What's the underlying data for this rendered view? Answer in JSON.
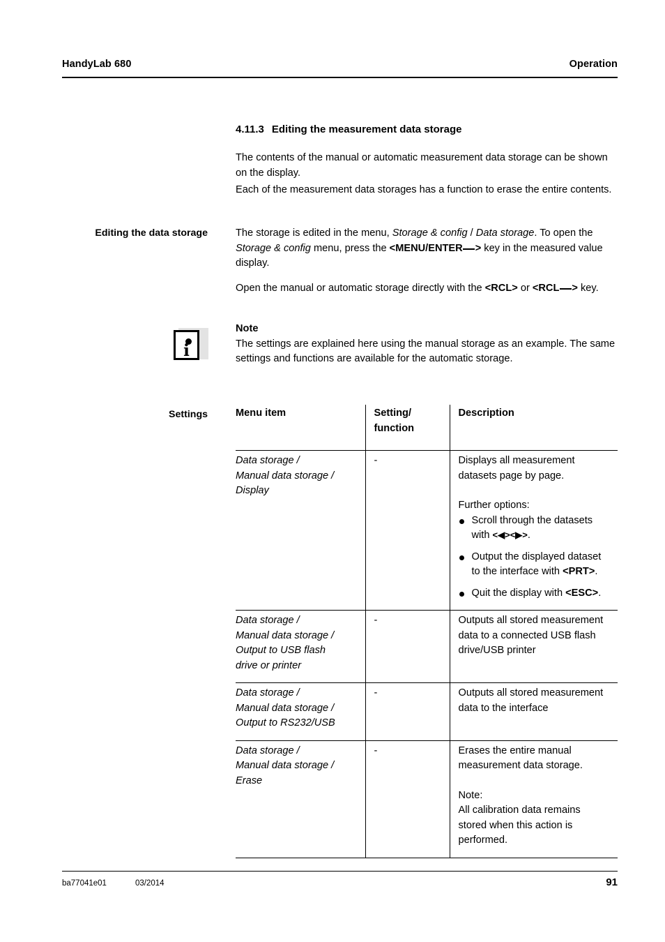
{
  "header": {
    "product": "HandyLab 680",
    "chapter": "Operation"
  },
  "footer": {
    "doc_number": "ba77041e01",
    "date": "03/2014",
    "page_number": "91"
  },
  "section": {
    "number": "4.11.3",
    "title": "Editing the measurement data storage",
    "intro_paragraph_1": "The contents of the manual or automatic measurement data storage can be shown on the display.",
    "intro_paragraph_2": "Each of the measurement data storages has a function to erase the entire contents."
  },
  "editing": {
    "marginal_label": "Editing the data storage",
    "p1_part1": "The storage is edited in the menu, ",
    "p1_menu1": "Storage & config",
    "p1_sep": " / ",
    "p1_menu2": "Data storage",
    "p1_part2": ". To open the ",
    "p1_menu3": "Storage & config",
    "p1_part3": " menu, press the ",
    "p1_key": "<MENU/ENTER",
    "p1_key_end": ">",
    "p1_part4": " key in the measured value display.",
    "p2_part1": "Open the manual or automatic storage directly with the ",
    "p2_key1": "<RCL>",
    "p2_part2": " or ",
    "p2_key2_start": "<RCL",
    "p2_key2_end": ">",
    "p2_part3": " key."
  },
  "note": {
    "icon": "info-icon",
    "icon_letter": "i",
    "title": "Note",
    "body": "The settings are explained here using the manual storage as an example. The same settings and functions are available for the automatic storage."
  },
  "settings_table": {
    "marginal_label": "Settings",
    "columns": [
      "Menu item",
      "Setting/ function",
      "Description"
    ],
    "column_headers": {
      "menu_item": "Menu item",
      "setting_function_line1": "Setting/",
      "setting_function_line2": "function",
      "description": "Description"
    },
    "rows": [
      {
        "menu_path": [
          "Data storage /",
          "Manual data storage /",
          "Display"
        ],
        "setting": "-",
        "description_lead": "Displays all measurement datasets page by page.",
        "description_sub_title": "Further options:",
        "options": [
          {
            "text_before": "Scroll through the datasets with ",
            "keys": "<◀><▶>",
            "text_after": "."
          },
          {
            "text_before": "Output the displayed dataset to the interface with ",
            "keys": "<PRT>",
            "text_after": "."
          },
          {
            "text_before": "Quit the display with ",
            "keys": "<ESC>",
            "text_after": "."
          }
        ]
      },
      {
        "menu_path": [
          "Data storage /",
          "Manual data storage /",
          "Output to USB flash",
          "drive or printer"
        ],
        "setting": "-",
        "description_lead": "Outputs all stored measurement data to a connected USB flash drive/USB printer"
      },
      {
        "menu_path": [
          "Data storage /",
          "Manual data storage /",
          "Output to RS232/USB"
        ],
        "setting": "-",
        "description_lead": "Outputs all stored measurement data to the interface"
      },
      {
        "menu_path": [
          "Data storage /",
          "Manual data storage /",
          "Erase"
        ],
        "setting": "-",
        "description_lead": "Erases the entire manual measurement data storage.",
        "note_label": "Note:",
        "note_text": "All calibration data remains stored when this action is performed."
      }
    ]
  }
}
